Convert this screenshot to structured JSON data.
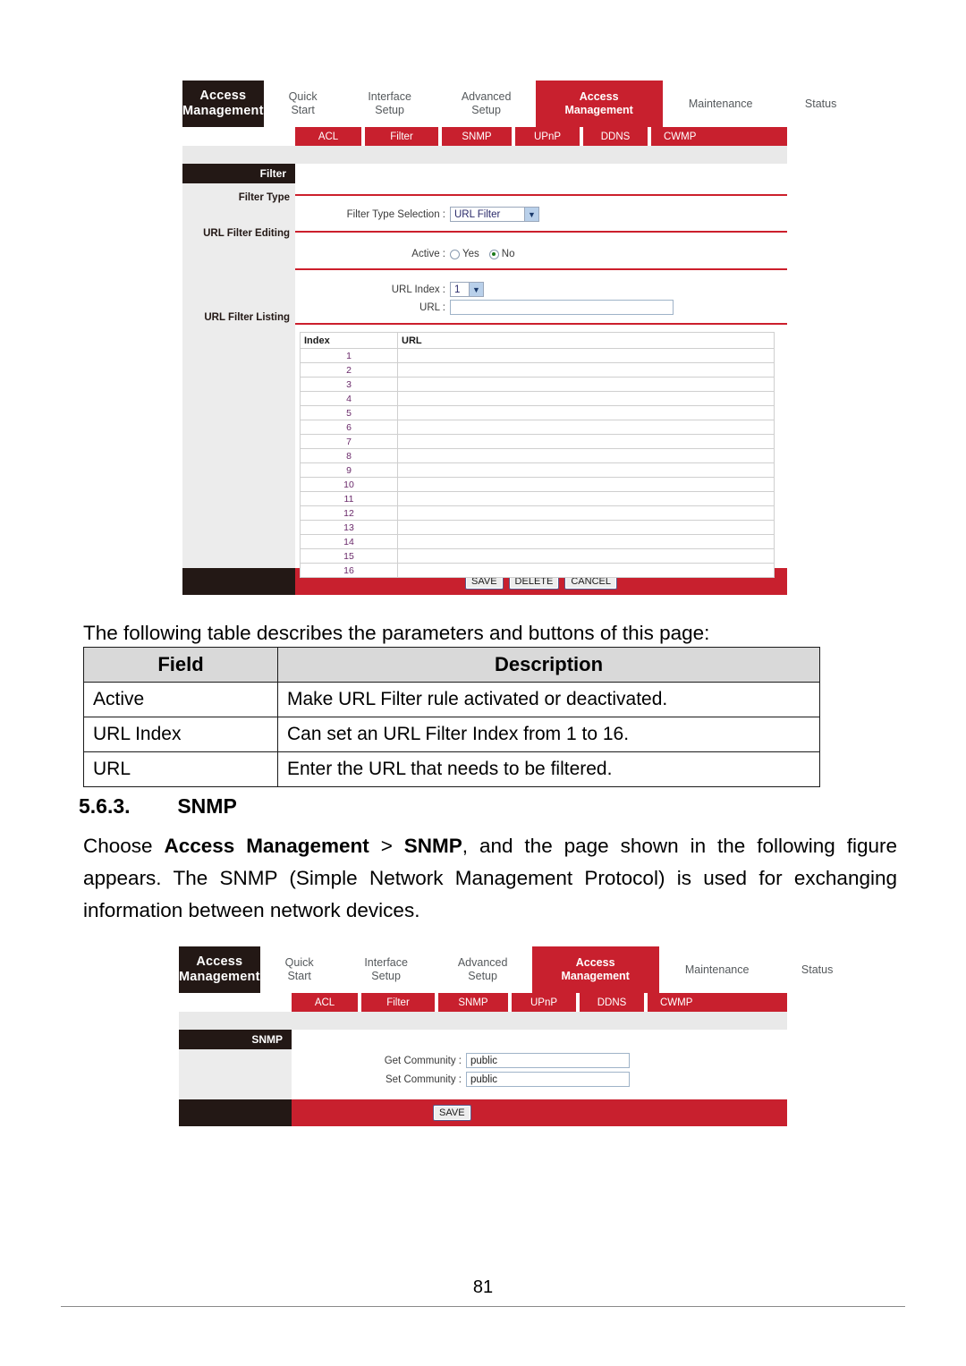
{
  "document": {
    "intro_text": "The following table describes the parameters and buttons of this page:",
    "section_number": "5.6.3.",
    "section_title": "SNMP",
    "body_paragraph": {
      "part1": "Choose ",
      "bold1": "Access Management",
      "part2": " > ",
      "bold2": "SNMP",
      "part3": ", and the page shown in the following figure appears. The SNMP (Simple Network Management Protocol) is used for exchanging information between network devices."
    },
    "page_number": "81"
  },
  "desc_table": {
    "headers": [
      "Field",
      "Description"
    ],
    "rows": [
      [
        "Active",
        "Make URL Filter rule activated or deactivated."
      ],
      [
        "URL Index",
        "Can set an URL Filter Index from 1 to 16."
      ],
      [
        "URL",
        "Enter the URL that needs to be filtered."
      ]
    ]
  },
  "colors": {
    "brand_red": "#c8202e",
    "rule_red": "#cc1f2c",
    "dark": "#231815",
    "panel_gray": "#ececec",
    "band_gray": "#e9e9e9",
    "table_header_gray": "#d9d9d9"
  },
  "router_ui": {
    "brand": {
      "line1": "Access",
      "line2": "Management"
    },
    "top_tabs": [
      {
        "id": "quick-start",
        "line1": "Quick",
        "line2": "Start",
        "active": false
      },
      {
        "id": "interface-setup",
        "line1": "Interface",
        "line2": "Setup",
        "active": false
      },
      {
        "id": "advanced-setup",
        "line1": "Advanced",
        "line2": "Setup",
        "active": false
      },
      {
        "id": "access-management",
        "line1": "Access",
        "line2": "Management",
        "active": true
      },
      {
        "id": "maintenance",
        "line1": "Maintenance",
        "line2": "",
        "active": false
      },
      {
        "id": "status",
        "line1": "Status",
        "line2": "",
        "active": false
      }
    ],
    "sub_tabs": [
      {
        "id": "acl",
        "label": "ACL"
      },
      {
        "id": "filter",
        "label": "Filter"
      },
      {
        "id": "snmp",
        "label": "SNMP"
      },
      {
        "id": "upnp",
        "label": "UPnP"
      },
      {
        "id": "ddns",
        "label": "DDNS"
      },
      {
        "id": "cwmp",
        "label": "CWMP"
      }
    ]
  },
  "filter_figure": {
    "panel_title": "Filter",
    "side_labels": {
      "filter_type": "Filter Type",
      "url_filter_editing": "URL Filter Editing",
      "url_filter_listing": "URL Filter Listing"
    },
    "filter_type_selection": {
      "label": "Filter Type Selection :",
      "value": "URL Filter"
    },
    "active": {
      "label": "Active :",
      "yes_label": "Yes",
      "no_label": "No",
      "selected": "No"
    },
    "url_index": {
      "label": "URL Index :",
      "value": "1"
    },
    "url": {
      "label": "URL :",
      "value": ""
    },
    "listing": {
      "headers": [
        "Index",
        "URL"
      ],
      "rows": [
        {
          "index": "1",
          "url": ""
        },
        {
          "index": "2",
          "url": ""
        },
        {
          "index": "3",
          "url": ""
        },
        {
          "index": "4",
          "url": ""
        },
        {
          "index": "5",
          "url": ""
        },
        {
          "index": "6",
          "url": ""
        },
        {
          "index": "7",
          "url": ""
        },
        {
          "index": "8",
          "url": ""
        },
        {
          "index": "9",
          "url": ""
        },
        {
          "index": "10",
          "url": ""
        },
        {
          "index": "11",
          "url": ""
        },
        {
          "index": "12",
          "url": ""
        },
        {
          "index": "13",
          "url": ""
        },
        {
          "index": "14",
          "url": ""
        },
        {
          "index": "15",
          "url": ""
        },
        {
          "index": "16",
          "url": ""
        }
      ]
    },
    "buttons": [
      {
        "id": "save",
        "label": "SAVE"
      },
      {
        "id": "delete",
        "label": "DELETE"
      },
      {
        "id": "cancel",
        "label": "CANCEL"
      }
    ]
  },
  "snmp_figure": {
    "panel_title": "SNMP",
    "get_community": {
      "label": "Get Community :",
      "value": "public"
    },
    "set_community": {
      "label": "Set Community :",
      "value": "public"
    },
    "buttons": [
      {
        "id": "save",
        "label": "SAVE"
      }
    ]
  }
}
